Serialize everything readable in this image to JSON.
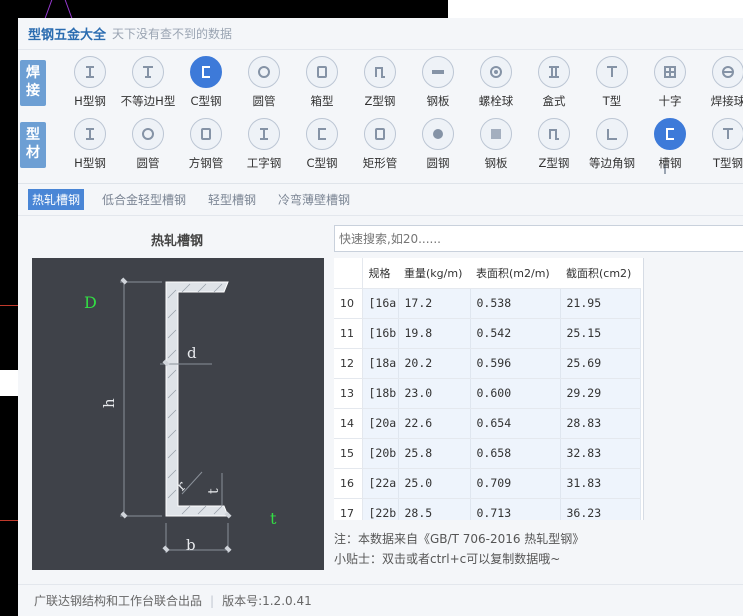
{
  "app": {
    "title": "型钢五金大全",
    "subtitle": "天下没有查不到的数据"
  },
  "rows": [
    {
      "tag": "焊接",
      "items": [
        {
          "label": "H型钢",
          "icon": "h-beam-icon",
          "glyph": "H"
        },
        {
          "label": "不等边H型",
          "icon": "unequal-h-icon",
          "glyph": "T2"
        },
        {
          "label": "C型钢",
          "icon": "c-channel-icon",
          "glyph": "C",
          "active": true
        },
        {
          "label": "圆管",
          "icon": "round-tube-icon",
          "glyph": "O"
        },
        {
          "label": "箱型",
          "icon": "box-section-icon",
          "glyph": "B"
        },
        {
          "label": "Z型钢",
          "icon": "z-section-icon",
          "glyph": "Z"
        },
        {
          "label": "钢板",
          "icon": "steel-plate-icon",
          "glyph": "P"
        },
        {
          "label": "螺栓球",
          "icon": "bolt-ball-icon",
          "glyph": "BB"
        },
        {
          "label": "盒式",
          "icon": "box-type-icon",
          "glyph": "II"
        },
        {
          "label": "T型",
          "icon": "t-section-icon",
          "glyph": "T"
        },
        {
          "label": "十字",
          "icon": "cross-section-icon",
          "glyph": "X"
        },
        {
          "label": "焊接球",
          "icon": "welded-ball-icon",
          "glyph": "WB"
        }
      ]
    },
    {
      "tag": "型材",
      "items": [
        {
          "label": "H型钢",
          "icon": "h-beam-icon",
          "glyph": "H"
        },
        {
          "label": "圆管",
          "icon": "round-tube-icon",
          "glyph": "O"
        },
        {
          "label": "方钢管",
          "icon": "square-tube-icon",
          "glyph": "B"
        },
        {
          "label": "工字钢",
          "icon": "i-beam-icon",
          "glyph": "H"
        },
        {
          "label": "C型钢",
          "icon": "c-channel-icon",
          "glyph": "C2"
        },
        {
          "label": "矩形管",
          "icon": "rect-tube-icon",
          "glyph": "B"
        },
        {
          "label": "圆钢",
          "icon": "round-bar-icon",
          "glyph": "RB"
        },
        {
          "label": "钢板",
          "icon": "steel-plate-icon",
          "glyph": "SP"
        },
        {
          "label": "Z型钢",
          "icon": "z-section-icon",
          "glyph": "Z"
        },
        {
          "label": "等边角钢",
          "icon": "angle-steel-icon",
          "glyph": "L"
        },
        {
          "label": "槽钢",
          "icon": "channel-steel-icon",
          "glyph": "C",
          "active": true
        },
        {
          "label": "T型钢",
          "icon": "t-section-icon",
          "glyph": "T"
        }
      ]
    }
  ],
  "subtabs": [
    {
      "label": "热轧槽钢",
      "active": true
    },
    {
      "label": "低合金轻型槽钢"
    },
    {
      "label": "轻型槽钢"
    },
    {
      "label": "冷弯薄壁槽钢"
    }
  ],
  "left": {
    "title": "热轧槽钢",
    "labels": {
      "D": "D",
      "d": "d",
      "h": "h",
      "r": "r",
      "t1": "t",
      "t2": "t",
      "b": "b"
    }
  },
  "search": {
    "placeholder": "快速搜索,如20......"
  },
  "table": {
    "headers": [
      "规格",
      "重量(kg/m)",
      "表面积(m2/m)",
      "截面积(cm2)"
    ],
    "rows": [
      {
        "idx": "10",
        "cells": [
          "[16a",
          "17.2",
          "0.538",
          "21.95"
        ]
      },
      {
        "idx": "11",
        "cells": [
          "[16b",
          "19.8",
          "0.542",
          "25.15"
        ]
      },
      {
        "idx": "12",
        "cells": [
          "[18a",
          "20.2",
          "0.596",
          "25.69"
        ]
      },
      {
        "idx": "13",
        "cells": [
          "[18b",
          "23.0",
          "0.600",
          "29.29"
        ]
      },
      {
        "idx": "14",
        "cells": [
          "[20a",
          "22.6",
          "0.654",
          "28.83"
        ]
      },
      {
        "idx": "15",
        "cells": [
          "[20b",
          "25.8",
          "0.658",
          "32.83"
        ]
      },
      {
        "idx": "16",
        "cells": [
          "[22a",
          "25.0",
          "0.709",
          "31.83"
        ]
      },
      {
        "idx": "17",
        "cells": [
          "[22b",
          "28.5",
          "0.713",
          "36.23"
        ]
      }
    ]
  },
  "notes": {
    "source": "注：本数据来自《GB/T 706-2016 热轧型钢》",
    "tip": "小贴士：双击或者ctrl+c可以复制数据哦~"
  },
  "footer": {
    "credit": "广联达钢结构和工作台联合出品",
    "version": "版本号:1.2.0.41"
  },
  "colors": {
    "accent": "#3d7ad9",
    "tag": "#6d9fd4",
    "diagram_bg": "#3f4249",
    "label_green": "#33dd44"
  }
}
